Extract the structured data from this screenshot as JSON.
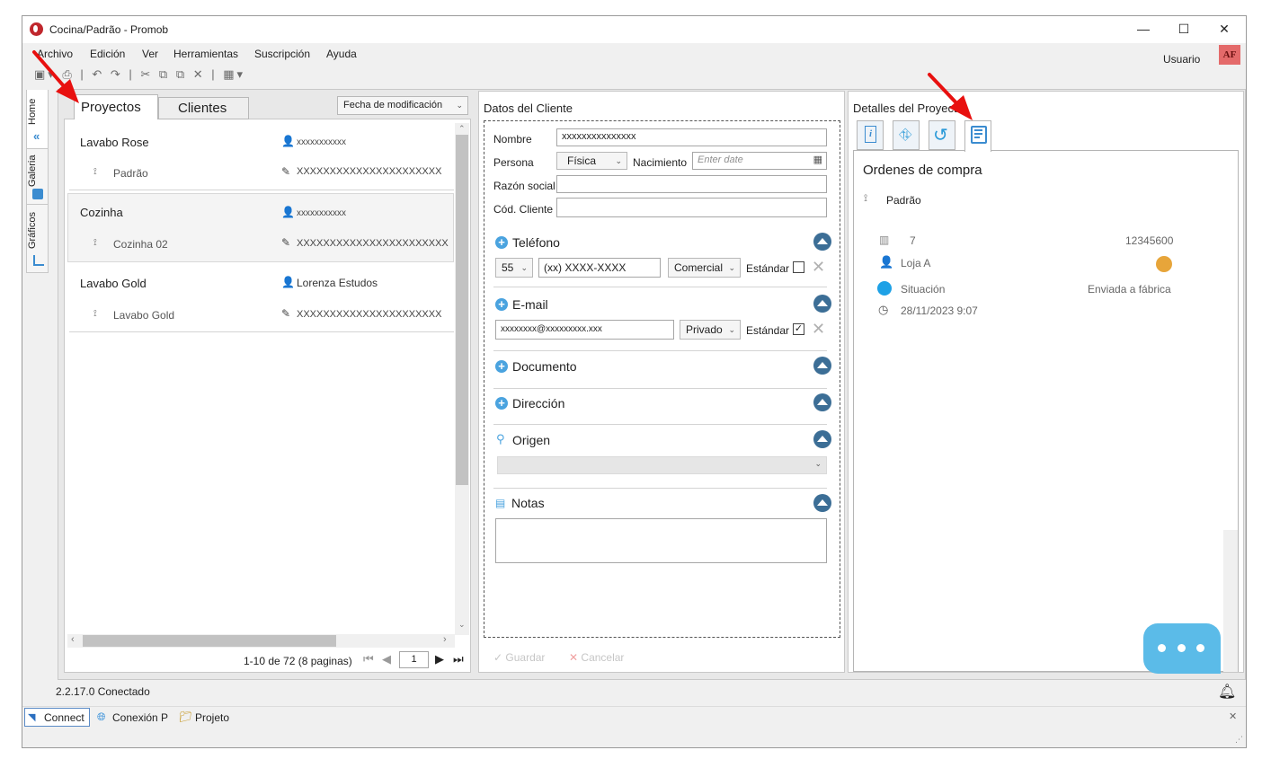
{
  "window": {
    "title": "Cocina/Padrão - Promob",
    "controls": {
      "minimize": "—",
      "maximize": "☐",
      "close": "✕"
    }
  },
  "menu": [
    "Archivo",
    "Edición",
    "Ver",
    "Herramientas",
    "Suscripción",
    "Ayuda"
  ],
  "toolbar_icons": "▣▾ ⎙ | ↶ ↷ | ✂ ⧉ ⧉ ✕ | ▦▾",
  "user": {
    "label": "Usuario",
    "initials": "AF"
  },
  "side_tabs": [
    "Home",
    "Galeria",
    "Gráficos"
  ],
  "left": {
    "tabs": [
      "Proyectos",
      "Clientes"
    ],
    "sort": "Fecha de modificación",
    "projects": [
      {
        "name": "Lavabo Rose",
        "client": "xxxxxxxxxxx",
        "variant": "Padrão",
        "author": "XXXXXXXXXXXXXXXXXXXXXX"
      },
      {
        "name": "Cozinha",
        "client": "xxxxxxxxxxx",
        "variant": "Cozinha 02",
        "author": "XXXXXXXXXXXXXXXXXXXXXXX"
      },
      {
        "name": "Lavabo Gold",
        "client": "Lorenza Estudos",
        "variant": "Lavabo Gold",
        "author": "XXXXXXXXXXXXXXXXXXXXXX"
      }
    ],
    "pager": {
      "text": "1-10 de 72 (8 paginas)",
      "page": "1"
    }
  },
  "middle": {
    "title": "Datos del Cliente",
    "labels": {
      "nombre": "Nombre",
      "persona": "Persona",
      "nacimiento": "Nacimiento",
      "razon": "Razón social",
      "cod": "Cód. Cliente"
    },
    "values": {
      "nombre": "xxxxxxxxxxxxxxx",
      "persona": "Física",
      "date_placeholder": "Enter date"
    },
    "sections": {
      "telefono": "Teléfono",
      "email": "E-mail",
      "documento": "Documento",
      "direccion": "Dirección",
      "origen": "Origen",
      "notas": "Notas"
    },
    "phone": {
      "ddd": "55",
      "number": "(xx) XXXX-XXXX",
      "type": "Comercial",
      "standard": "Estándar"
    },
    "email": {
      "address": "xxxxxxxx@xxxxxxxxx.xxx",
      "type": "Privado",
      "standard": "Estándar"
    },
    "footer": {
      "save": "Guardar",
      "cancel": "Cancelar"
    }
  },
  "right": {
    "title": "Detalles del Proyecto",
    "section": "Ordenes de compra",
    "variant": "Padrão",
    "order": {
      "number": "7",
      "code": "12345600",
      "store": "Loja A",
      "status_label": "Situación",
      "status_value": "Enviada a fábrica",
      "date": "28/11/2023 9:07"
    }
  },
  "status": {
    "version": "2.2.17.0 Conectado",
    "tabs": [
      "Connect",
      "Conexión P",
      "Projeto"
    ]
  },
  "colors": {
    "accent": "#4aa3df",
    "collapse": "#3c6e96",
    "chat": "#5bbbe8",
    "logo": "#c0272d",
    "avatar": "#e46a6a",
    "arrow": "#e8100f"
  }
}
